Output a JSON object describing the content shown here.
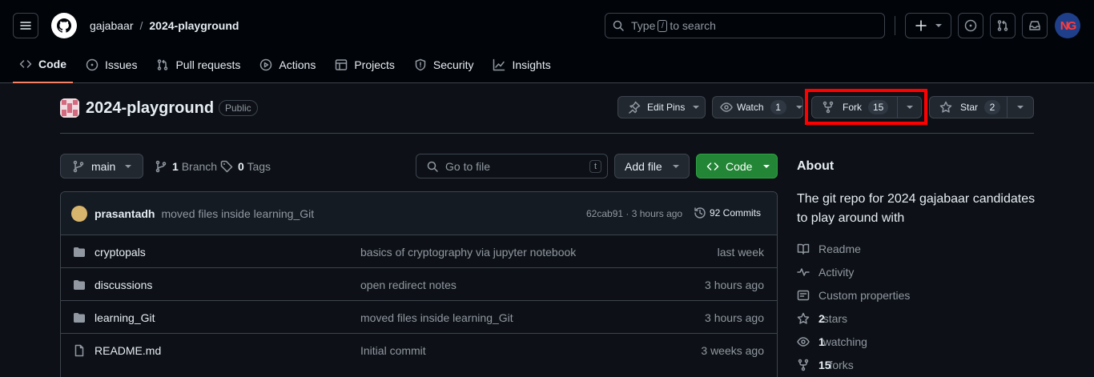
{
  "header": {
    "owner": "gajabaar",
    "separator": "/",
    "repo": "2024-playground",
    "search_prefix": "Type",
    "search_key": "/",
    "search_suffix": "to search",
    "avatar_initials": "NG"
  },
  "tabs": [
    {
      "label": "Code",
      "icon": "code-icon",
      "active": true
    },
    {
      "label": "Issues",
      "icon": "issue-opened-icon"
    },
    {
      "label": "Pull requests",
      "icon": "git-pull-request-icon"
    },
    {
      "label": "Actions",
      "icon": "play-icon"
    },
    {
      "label": "Projects",
      "icon": "table-icon"
    },
    {
      "label": "Security",
      "icon": "shield-icon"
    },
    {
      "label": "Insights",
      "icon": "graph-icon"
    }
  ],
  "repo": {
    "title": "2024-playground",
    "visibility": "Public",
    "edit_pins": "Edit Pins",
    "watch_label": "Watch",
    "watch_count": "1",
    "fork_label": "Fork",
    "fork_count": "15",
    "star_label": "Star",
    "star_count": "2"
  },
  "filenav": {
    "branch": "main",
    "branch_count": "1",
    "branch_label": "Branch",
    "tag_count": "0",
    "tag_label": "Tags",
    "goto_placeholder": "Go to file",
    "goto_key": "t",
    "add_file": "Add file",
    "code": "Code"
  },
  "commit": {
    "author": "prasantadh",
    "message": "moved files inside learning_Git",
    "sha_time": "62cab91 · 3 hours ago",
    "commits": "92 Commits"
  },
  "files": [
    {
      "name": "cryptopals",
      "type": "dir",
      "message": "basics of cryptography via jupyter notebook",
      "date": "last week"
    },
    {
      "name": "discussions",
      "type": "dir",
      "message": "open redirect notes",
      "date": "3 hours ago"
    },
    {
      "name": "learning_Git",
      "type": "dir",
      "message": "moved files inside learning_Git",
      "date": "3 hours ago"
    },
    {
      "name": "README.md",
      "type": "file",
      "message": "Initial commit",
      "date": "3 weeks ago"
    }
  ],
  "about": {
    "title": "About",
    "description": "The git repo for 2024 gajabaar candidates to play around with",
    "readme": "Readme",
    "activity": "Activity",
    "custom_properties": "Custom properties",
    "stars_count": "2",
    "stars_label": "stars",
    "watching_count": "1",
    "watching_label": "watching",
    "forks_count": "15",
    "forks_label": "forks"
  },
  "colors": {
    "background": "#0d1117",
    "header": "#010409",
    "border": "#3d444d",
    "accent_tab": "#f78166",
    "code_button": "#238636",
    "highlight": "#ff0000"
  }
}
